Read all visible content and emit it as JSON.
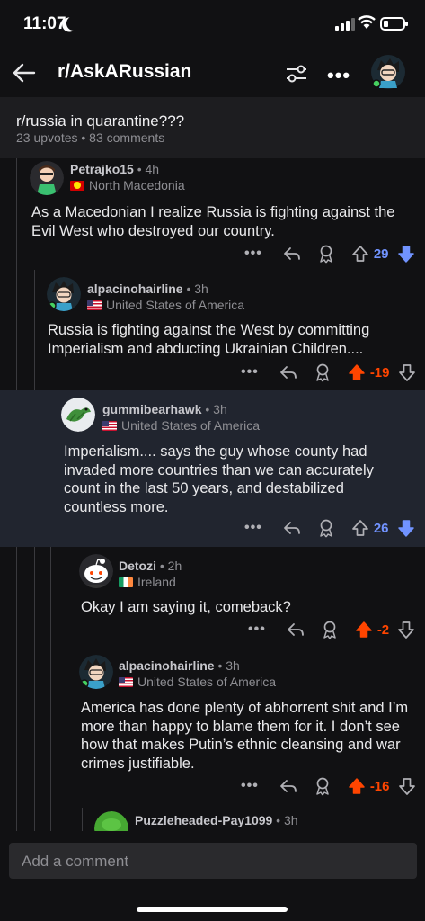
{
  "status": {
    "time": "11:07"
  },
  "header": {
    "subreddit": "r/AskARussian"
  },
  "post": {
    "title": "r/russia in quarantine???",
    "meta": "23 upvotes • 83 comments"
  },
  "comments": [
    {
      "author": "Petrajko15",
      "age": " • 4h",
      "country": "North Macedonia",
      "body": "As a Macedonian I realize Russia is fighting against the Evil West who destroyed our country.",
      "score": "29"
    },
    {
      "author": "alpacinohairline",
      "age": " • 3h",
      "country": "United States of America",
      "body": "Russia is fighting against the West by committing Imperialism and abducting Ukrainian Children....",
      "score": "-19"
    },
    {
      "author": "gummibearhawk",
      "age": " • 3h",
      "country": "United States of America",
      "body": "Imperialism.... says the guy whose county had invaded more countries than we can accurately count in the last 50 years, and destabilized countless more.",
      "score": "26"
    },
    {
      "author": "Detozi",
      "age": " • 2h",
      "country": "Ireland",
      "body": "Okay I am saying it, comeback?",
      "score": "-2"
    },
    {
      "author": "alpacinohairline",
      "age": " • 3h",
      "country": "United States of America",
      "body": "America has done plenty of abhorrent shit and I’m more than happy to blame them for it. I don’t see how that makes Putin’s ethnic cleansing and war crimes justifiable.",
      "score": "-16"
    },
    {
      "author": "Puzzleheaded-Pay1099",
      "age": " • 3h"
    }
  ],
  "composer": {
    "placeholder": "Add a comment"
  },
  "colors": {
    "upvote": "#ff4500",
    "downvote": "#7193ff",
    "highlight": "#21252f"
  }
}
